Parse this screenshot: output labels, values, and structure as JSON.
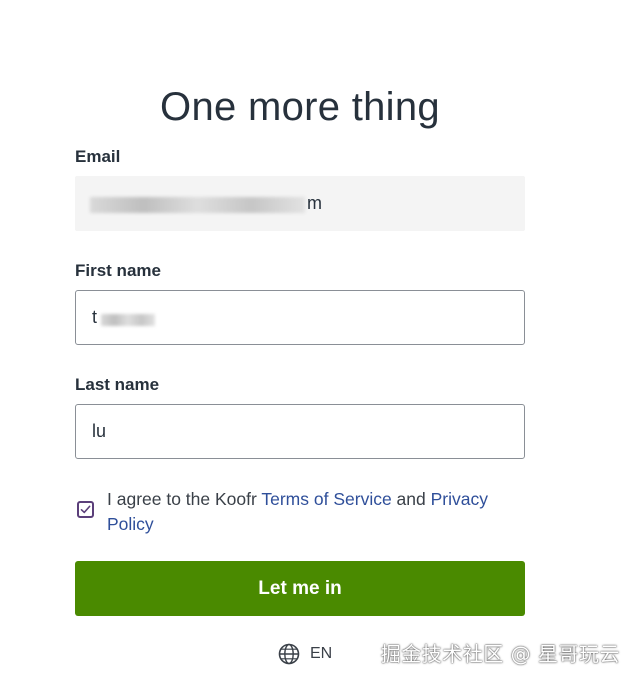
{
  "page": {
    "title": "One more thing"
  },
  "form": {
    "email": {
      "label": "Email",
      "value": "m"
    },
    "first_name": {
      "label": "First name",
      "value": "t"
    },
    "last_name": {
      "label": "Last name",
      "value": "lu"
    },
    "agree": {
      "checked": true,
      "text_prefix": "I agree to the Koofr ",
      "terms_link": "Terms of Service",
      "text_middle": " and ",
      "privacy_link": "Privacy Policy"
    },
    "submit_label": "Let me in"
  },
  "language": {
    "icon": "globe-icon",
    "current": "EN"
  },
  "watermark": {
    "text": "掘金技术社区 @ 星哥玩云"
  },
  "colors": {
    "primary_button": "#4a8a00",
    "link": "#2f4f9a",
    "checkbox": "#5b3f7a"
  }
}
